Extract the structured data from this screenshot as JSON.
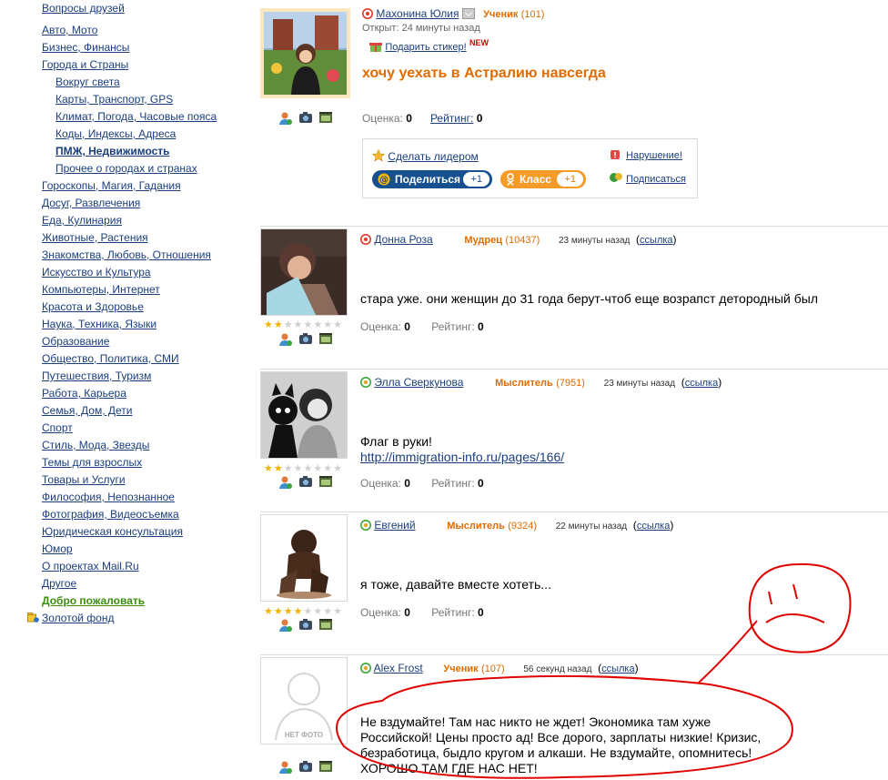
{
  "sidebar": {
    "items": [
      {
        "label": "Вопросы друзей"
      },
      {
        "label": "Авто, Мото"
      },
      {
        "label": "Бизнес, Финансы"
      },
      {
        "label": "Города и Страны"
      },
      {
        "label": "Вокруг света"
      },
      {
        "label": "Карты, Транспорт, GPS"
      },
      {
        "label": "Климат, Погода, Часовые пояса"
      },
      {
        "label": "Коды, Индексы, Адреса"
      },
      {
        "label": "ПМЖ, Недвижимость"
      },
      {
        "label": "Прочее о городах и странах"
      },
      {
        "label": "Гороскопы, Магия, Гадания"
      },
      {
        "label": "Досуг, Развлечения"
      },
      {
        "label": "Еда, Кулинария"
      },
      {
        "label": "Животные, Растения"
      },
      {
        "label": "Знакомства, Любовь, Отношения"
      },
      {
        "label": "Искусство и Культура"
      },
      {
        "label": "Компьютеры, Интернет"
      },
      {
        "label": "Красота и Здоровье"
      },
      {
        "label": "Наука, Техника, Языки"
      },
      {
        "label": "Образование"
      },
      {
        "label": "Общество, Политика, СМИ"
      },
      {
        "label": "Путешествия, Туризм"
      },
      {
        "label": "Работа, Карьера"
      },
      {
        "label": "Семья, Дом, Дети"
      },
      {
        "label": "Спорт"
      },
      {
        "label": "Стиль, Мода, Звезды"
      },
      {
        "label": "Темы для взрослых"
      },
      {
        "label": "Товары и Услуги"
      },
      {
        "label": "Философия, Непознанное"
      },
      {
        "label": "Фотография, Видеосъемка"
      },
      {
        "label": "Юридическая консультация"
      },
      {
        "label": "Юмор"
      },
      {
        "label": "О проектах Mail.Ru"
      },
      {
        "label": "Другое"
      },
      {
        "label": "Добро пожаловать"
      },
      {
        "label": "Золотой фонд"
      }
    ]
  },
  "question": {
    "author": "Махонина Юлия",
    "rank": "Ученик",
    "rank_points": "(101)",
    "opened": "Открыт: 24 минуты назад",
    "gift_label": "Подарить стикер!",
    "new_badge": "NEW",
    "title": "хочу уехать в Астралию навсегда",
    "score_label": "Оценка:",
    "score_value": "0",
    "rating_label": "Рейтинг:",
    "rating_value": "0",
    "make_leader": "Сделать лидером",
    "violation": "Нарушение!",
    "share": "Поделиться",
    "share_count": "+1",
    "class_label": "Класс",
    "class_count": "+1",
    "subscribe": "Подписаться"
  },
  "answers": [
    {
      "author": "Донна Роза",
      "rank": "Мудрец",
      "rank_points": "(10437)",
      "time": "23 минуты назад",
      "link": "ссылка",
      "text": "стара уже. они женщин до 31 года берут-чтоб еще возрапст детородный был",
      "score_label": "Оценка:",
      "score_value": "0",
      "rating_label": "Рейтинг:",
      "rating_value": "0",
      "stars": 2
    },
    {
      "author": "Элла Сверкунова",
      "rank": "Мыслитель",
      "rank_points": "(7951)",
      "time": "23 минуты назад",
      "link": "ссылка",
      "text": "Флаг в руки!",
      "url": "http://immigration-info.ru/pages/166/",
      "score_label": "Оценка:",
      "score_value": "0",
      "rating_label": "Рейтинг:",
      "rating_value": "0",
      "stars": 2
    },
    {
      "author": "Евгений",
      "rank": "Мыслитель",
      "rank_points": "(9324)",
      "time": "22 минуты назад",
      "link": "ссылка",
      "text": "я тоже, давайте вместе хотеть...",
      "score_label": "Оценка:",
      "score_value": "0",
      "rating_label": "Рейтинг:",
      "rating_value": "0",
      "stars": 4
    },
    {
      "author": "Alex Frost",
      "rank": "Ученик",
      "rank_points": "(107)",
      "time": "56 секунд назад",
      "link": "ссылка",
      "text": "Не вздумайте! Там нас никто не ждет! Экономика там хуже Российской! Цены просто ад! Все дорого, зарплаты низкие! Кризис, безработица, быдло кругом и алкаши. Не вздумайте, опомнитесь! ХОРОШО ТАМ ГДЕ НАС НЕТ!",
      "no_photo": "НЕТ ФОТО"
    }
  ],
  "colors": {
    "link": "#1a3e7e",
    "rank": "#e06c00",
    "green": "#3a8f0b",
    "annotation_red": "#e00000"
  }
}
